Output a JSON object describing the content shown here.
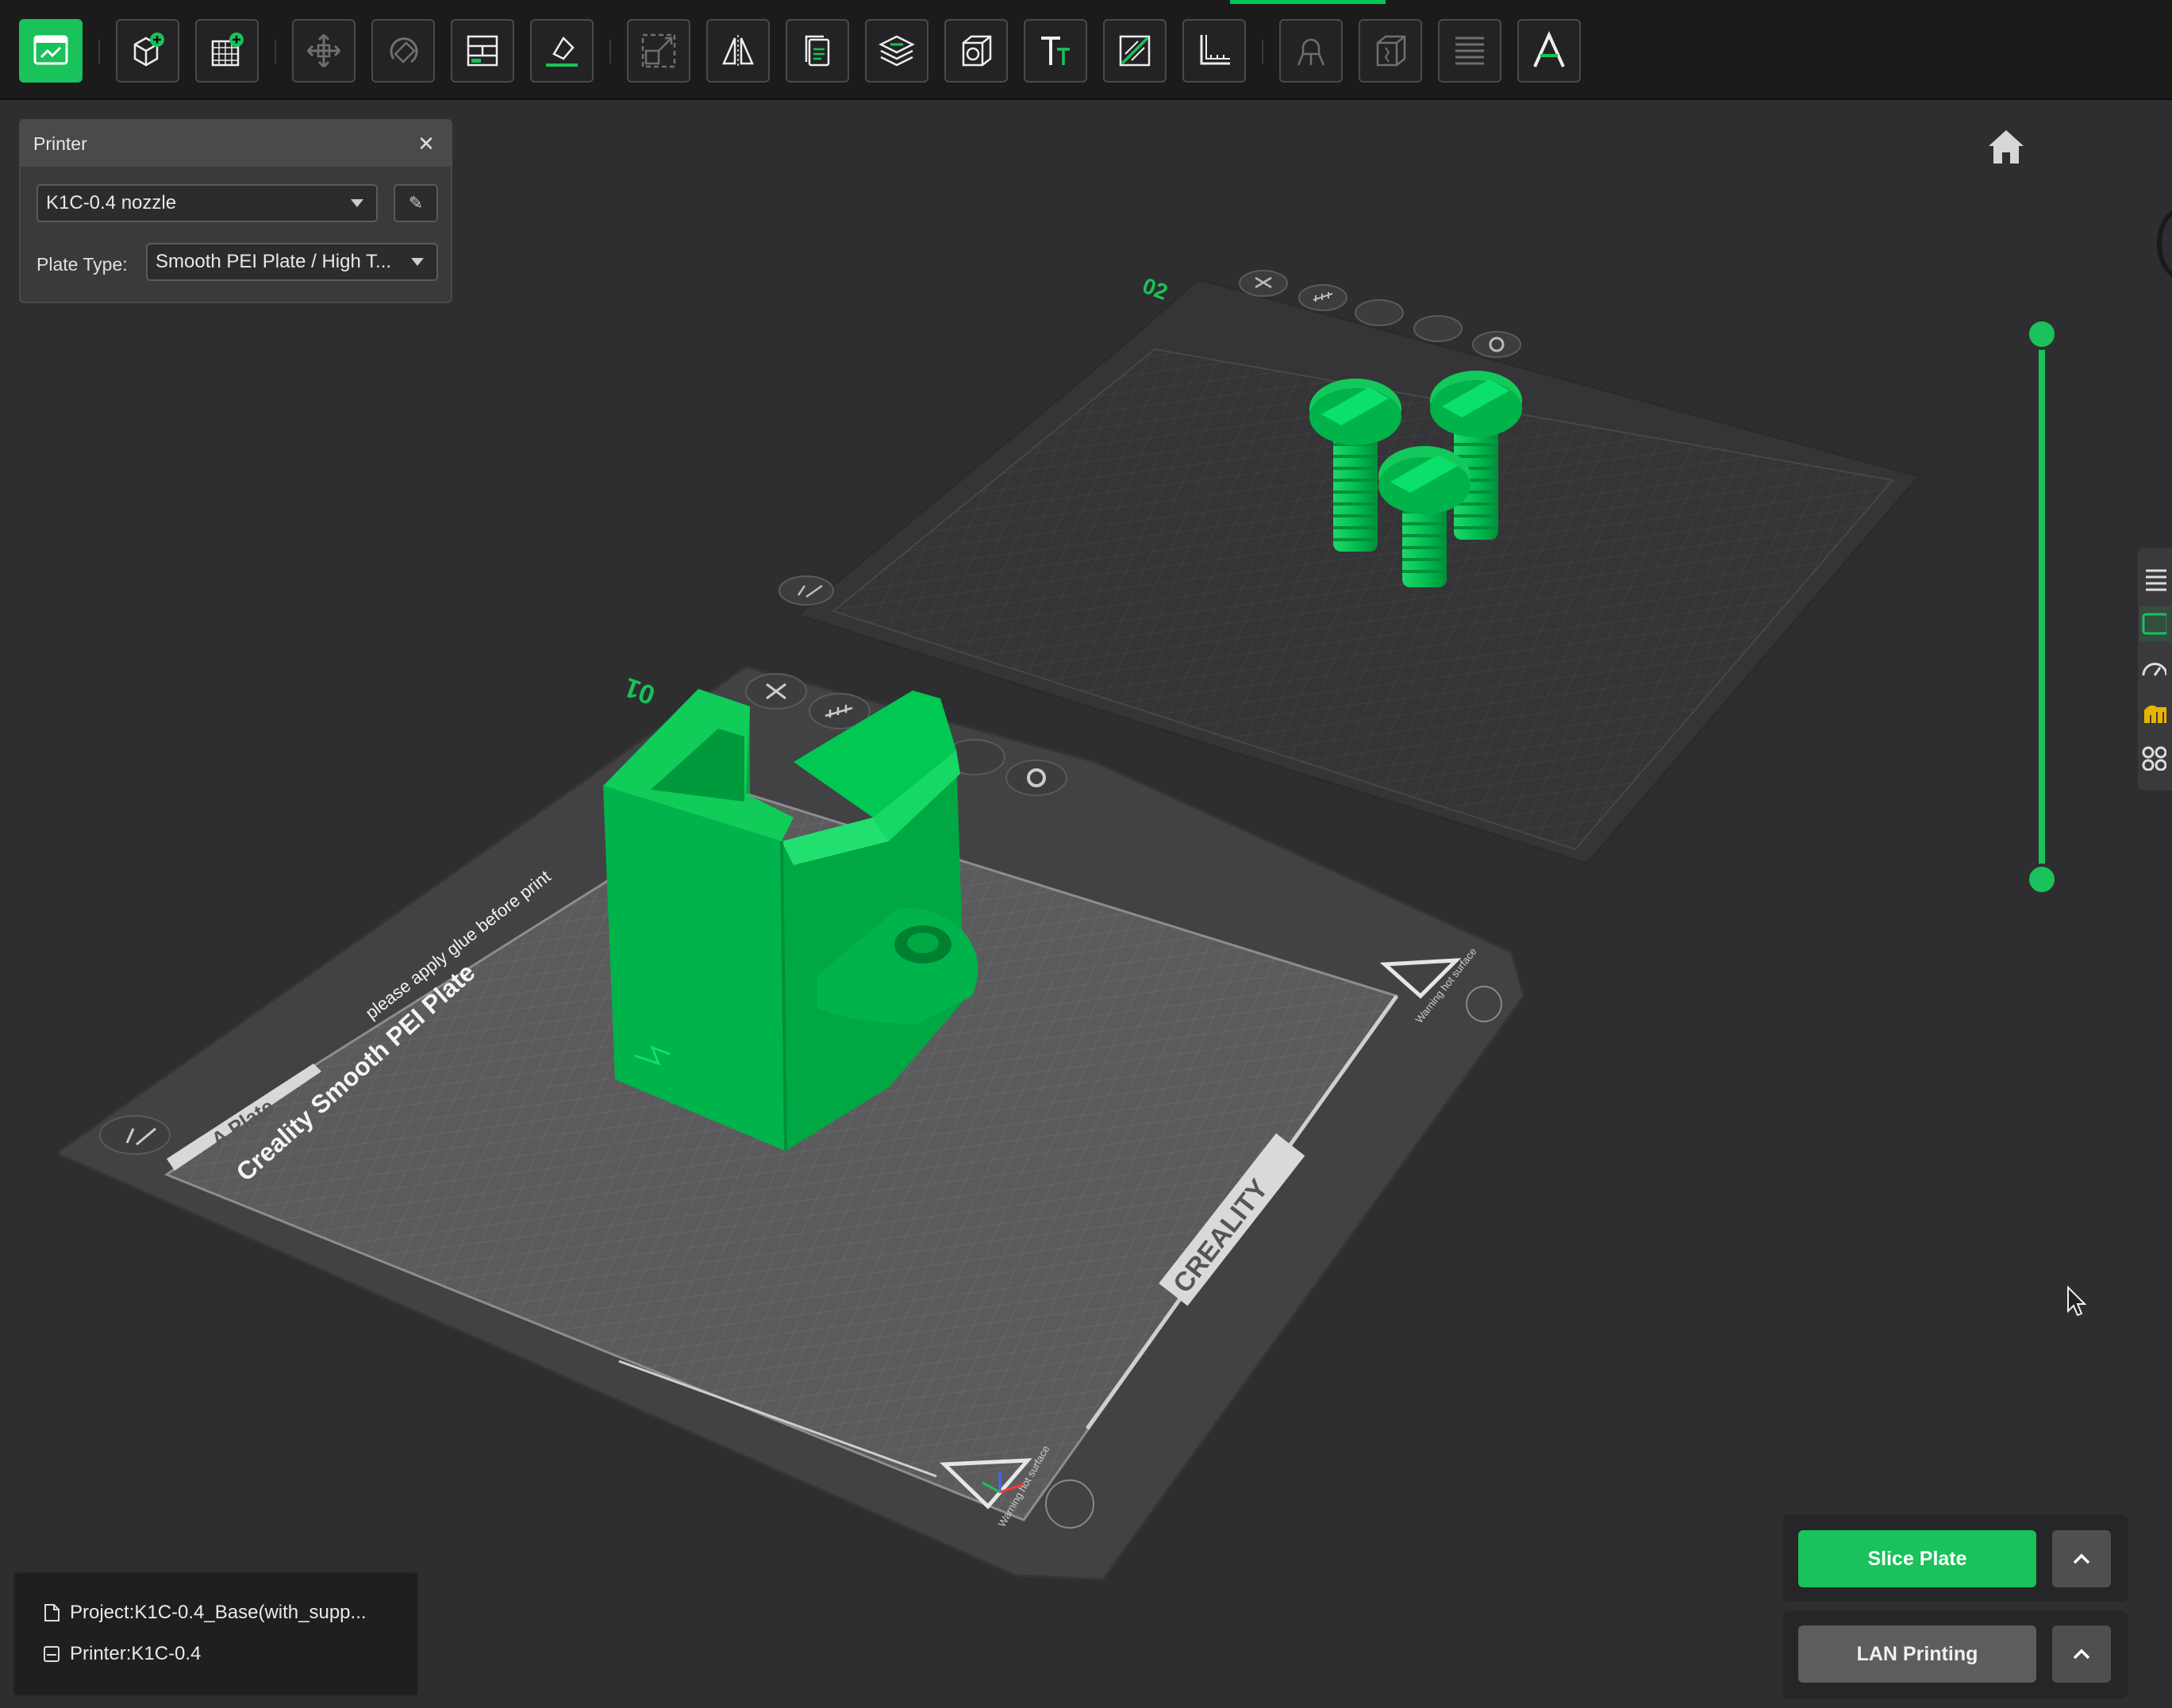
{
  "toolbar": {
    "buttons": [
      {
        "name": "prepare-view-icon",
        "active": true
      },
      {
        "name": "add-object-icon"
      },
      {
        "name": "add-plate-icon"
      },
      {
        "name": "move-icon",
        "dim": true
      },
      {
        "name": "rotate-icon",
        "dim": true
      },
      {
        "name": "arrange-icon"
      },
      {
        "name": "lay-on-face-icon"
      },
      {
        "name": "scale-icon",
        "dim": true
      },
      {
        "name": "mirror-icon"
      },
      {
        "name": "copy-icon"
      },
      {
        "name": "layers-icon"
      },
      {
        "name": "hollow-icon"
      },
      {
        "name": "text-icon"
      },
      {
        "name": "cut-icon"
      },
      {
        "name": "measure-icon"
      },
      {
        "name": "support-paint-icon",
        "dim": true
      },
      {
        "name": "seam-paint-icon",
        "dim": true
      },
      {
        "name": "variable-layer-icon",
        "dim": true
      },
      {
        "name": "assembly-text-icon"
      }
    ]
  },
  "printer_panel": {
    "title": "Printer",
    "printer_value": "K1C-0.4 nozzle",
    "plate_type_label": "Plate Type:",
    "plate_type_value": "Smooth PEI Plate / High T..."
  },
  "scene": {
    "plate1": {
      "number": "01",
      "bed_text": "Creality Smooth PEI Plate",
      "hint_text": "please apply glue before print",
      "plate_tag": "A Plate",
      "brand": "CREALITY",
      "warning": "Warning hot surface"
    },
    "plate2": {
      "number": "02"
    }
  },
  "info": {
    "project": "Project:K1C-0.4_Base(with_supp...",
    "printer": "Printer:K1C-0.4"
  },
  "actions": {
    "slice_label": "Slice Plate",
    "lan_label": "LAN Printing"
  },
  "colors": {
    "accent": "#19c25a",
    "model": "#00b34a",
    "bed": "#5b5b5d",
    "background": "#2e2e30"
  }
}
